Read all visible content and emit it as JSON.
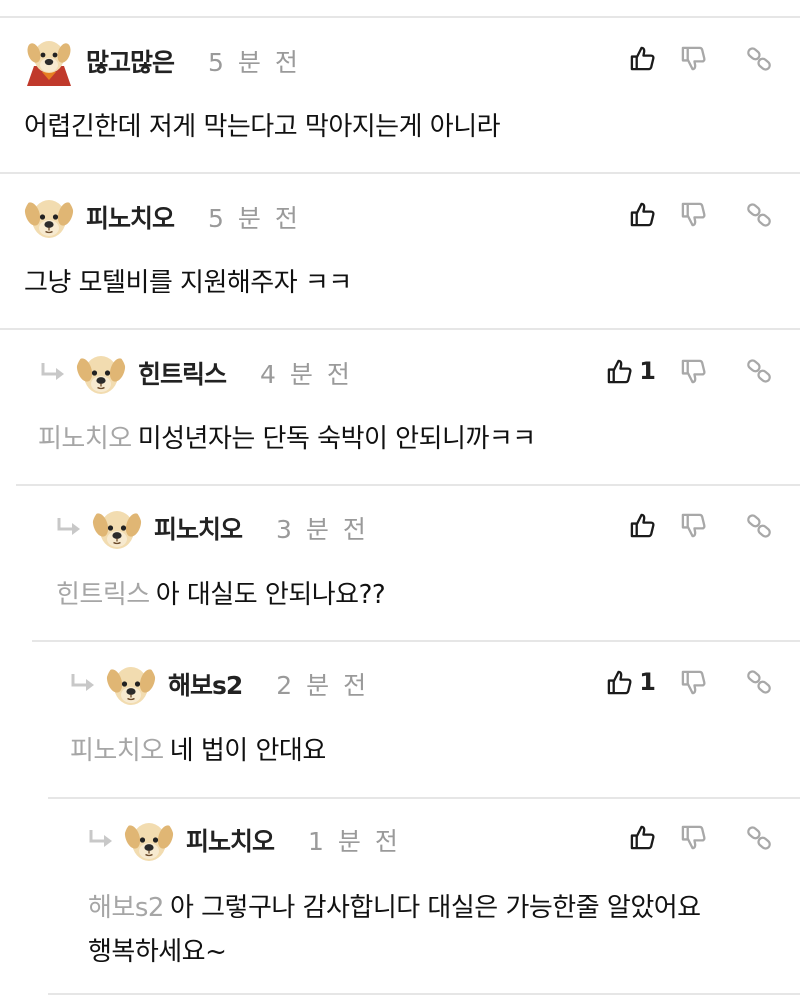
{
  "comments": [
    {
      "author": "많고많은",
      "time": "5 분 전",
      "text": "어렵긴한데 저게 막는다고 막아지는게 아니라",
      "mention": "",
      "likes": ""
    },
    {
      "author": "피노치오",
      "time": "5 분 전",
      "text": "그냥 모텔비를 지원해주자 ㅋㅋ",
      "mention": "",
      "likes": ""
    },
    {
      "author": "힌트릭스",
      "time": "4 분 전",
      "text": "미성년자는 단독 숙박이 안되니까ㅋㅋ",
      "mention": "피노치오",
      "likes": "1"
    },
    {
      "author": "피노치오",
      "time": "3 분 전",
      "text": "아 대실도 안되나요??",
      "mention": "힌트릭스",
      "likes": ""
    },
    {
      "author": "해보s2",
      "time": "2 분 전",
      "text": "네 법이 안대요",
      "mention": "피노치오",
      "likes": "1"
    },
    {
      "author": "피노치오",
      "time": "1 분 전",
      "text_line1": "아 그렇구나 감사합니다 대실은 가능한줄 알았어요",
      "text_line2": "행복하세요~",
      "mention": "해보s2",
      "likes": ""
    }
  ],
  "icons": {
    "like": "thumbs-up-icon",
    "dislike": "thumbs-down-icon",
    "link": "link-icon",
    "reply": "reply-arrow-icon"
  }
}
